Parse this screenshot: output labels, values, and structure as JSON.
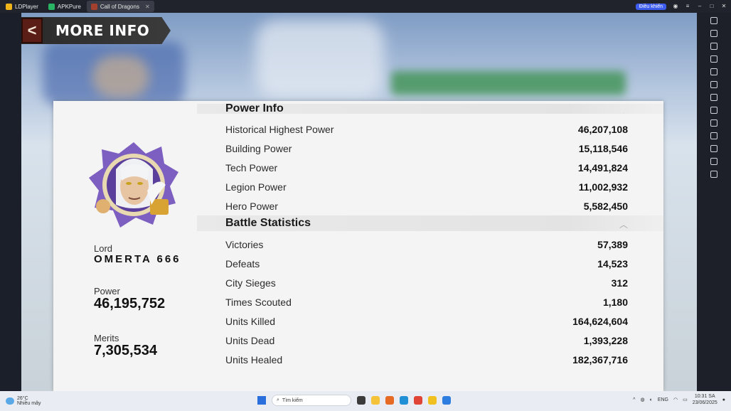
{
  "browser": {
    "tabs": [
      {
        "label": "LDPlayer",
        "color": "#f1b51c"
      },
      {
        "label": "APKPure",
        "color": "#28b463"
      },
      {
        "label": "Call of Dragons",
        "color": "#a3402e"
      }
    ],
    "pill_label": "Điều khiển"
  },
  "header": {
    "title": "MORE INFO",
    "back_glyph": "<"
  },
  "profile": {
    "lord_label": "Lord",
    "lord_name": "OMERTA 666",
    "power_label": "Power",
    "power_value": "46,195,752",
    "merits_label": "Merits",
    "merits_value": "7,305,534"
  },
  "sections": {
    "power": {
      "title": "Power Info",
      "rows": [
        {
          "label": "Historical Highest Power",
          "value": "46,207,108"
        },
        {
          "label": "Building Power",
          "value": "15,118,546"
        },
        {
          "label": "Tech Power",
          "value": "14,491,824"
        },
        {
          "label": "Legion Power",
          "value": "11,002,932"
        },
        {
          "label": "Hero Power",
          "value": "5,582,450"
        }
      ]
    },
    "battle": {
      "title": "Battle Statistics",
      "rows": [
        {
          "label": "Victories",
          "value": "57,389"
        },
        {
          "label": "Defeats",
          "value": "14,523"
        },
        {
          "label": "City Sieges",
          "value": "312"
        },
        {
          "label": "Times Scouted",
          "value": "1,180"
        },
        {
          "label": "Units Killed",
          "value": "164,624,604"
        },
        {
          "label": "Units Dead",
          "value": "1,393,228"
        },
        {
          "label": "Units Healed",
          "value": "182,367,716"
        }
      ]
    }
  },
  "taskbar": {
    "weather_temp": "26°C",
    "weather_desc": "Nhiều mây",
    "search_placeholder": "Tìm kiếm",
    "lang": "ENG",
    "time": "10:31 SA",
    "date": "23/06/2025"
  }
}
